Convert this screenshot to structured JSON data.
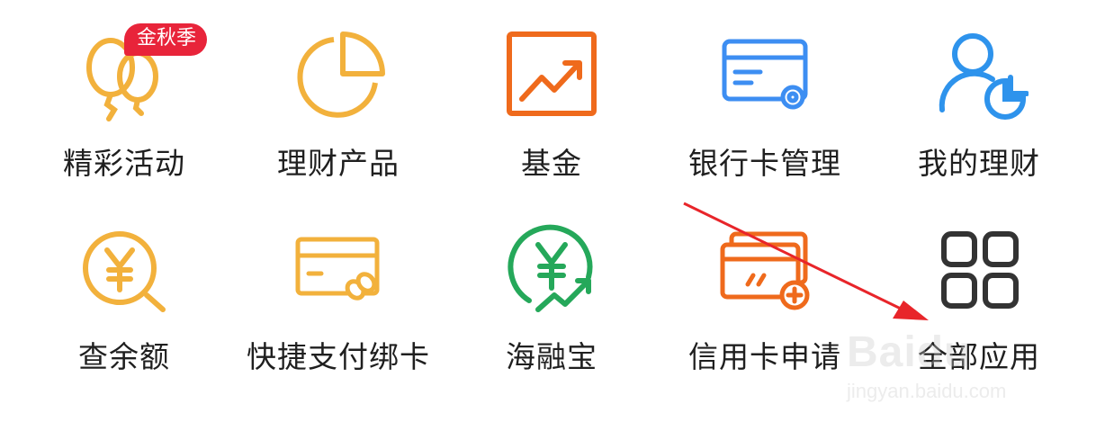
{
  "grid": {
    "items": [
      {
        "label": "精彩活动",
        "icon": "balloons-icon",
        "badge": "金秋季",
        "color": "#f2b13c"
      },
      {
        "label": "理财产品",
        "icon": "pie-chart-icon",
        "color": "#f2b13c"
      },
      {
        "label": "基金",
        "icon": "trend-chart-icon",
        "color": "#ef6a1c"
      },
      {
        "label": "银行卡管理",
        "icon": "card-settings-icon",
        "color": "#3d8ef2"
      },
      {
        "label": "我的理财",
        "icon": "user-pie-icon",
        "color": "#2e93ec"
      },
      {
        "label": "查余额",
        "icon": "yuan-search-icon",
        "color": "#f2b13c"
      },
      {
        "label": "快捷支付绑卡",
        "icon": "card-link-icon",
        "color": "#f2b13c"
      },
      {
        "label": "海融宝",
        "icon": "yuan-growth-icon",
        "color": "#25a85a"
      },
      {
        "label": "信用卡申请",
        "icon": "credit-card-add-icon",
        "color": "#ef6a1c"
      },
      {
        "label": "全部应用",
        "icon": "grid-apps-icon",
        "color": "#333333"
      }
    ]
  },
  "annotation": {
    "icon": "red-arrow-icon",
    "color": "#e8252a"
  },
  "watermark": {
    "logo": "Baidu",
    "url": "jingyan.baidu.com"
  }
}
